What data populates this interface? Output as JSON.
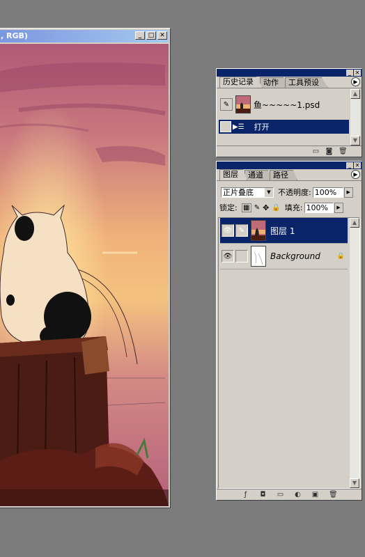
{
  "document": {
    "title_fragment": ", RGB)",
    "buttons": {
      "minimize": "_",
      "maximize": "□",
      "close": "✕"
    }
  },
  "history_panel": {
    "tabs": [
      "历史记录",
      "动作",
      "工具预设"
    ],
    "active_tab": "历史记录",
    "snapshot_label": "鱼~~~~~1.psd",
    "states": [
      {
        "label": "打开",
        "selected": true
      }
    ],
    "footer_icons": [
      "new-document-from-state-icon",
      "snapshot-camera-icon",
      "trash-icon"
    ]
  },
  "layers_panel": {
    "tabs": [
      "图层",
      "通道",
      "路径"
    ],
    "active_tab": "图层",
    "blend_mode": "正片叠底",
    "opacity_label": "不透明度:",
    "opacity_value": "100%",
    "lock_label": "锁定:",
    "fill_label": "填充:",
    "fill_value": "100%",
    "layers": [
      {
        "name": "图层 1",
        "visible": true,
        "selected": true,
        "locked": false
      },
      {
        "name": "Background",
        "visible": true,
        "selected": false,
        "locked": true
      }
    ],
    "footer_icons": [
      "layer-style-icon",
      "layer-mask-icon",
      "new-group-icon",
      "adjustment-layer-icon",
      "new-layer-icon",
      "trash-icon"
    ]
  },
  "colors": {
    "workspace": "#7b7b7b",
    "panel": "#d4d0c8",
    "selection": "#0a246a",
    "doc_title_start": "#7a96df",
    "doc_title_end": "#a6caf0"
  }
}
